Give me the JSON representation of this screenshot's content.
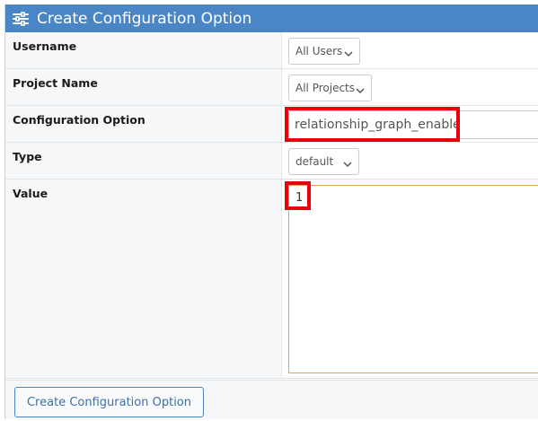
{
  "header": {
    "title": "Create Configuration Option",
    "icon": "sliders-icon"
  },
  "form": {
    "username": {
      "label": "Username",
      "value": "All Users"
    },
    "project_name": {
      "label": "Project Name",
      "value": "All Projects"
    },
    "configuration_option": {
      "label": "Configuration Option",
      "value": "relationship_graph_enable"
    },
    "type": {
      "label": "Type",
      "value": "default"
    },
    "value": {
      "label": "Value",
      "value": "1"
    }
  },
  "footer": {
    "submit_label": "Create Configuration Option"
  },
  "colors": {
    "header_bg": "#4a86c5",
    "highlight": "#e8000b",
    "textarea_border": "#e8a05a"
  }
}
